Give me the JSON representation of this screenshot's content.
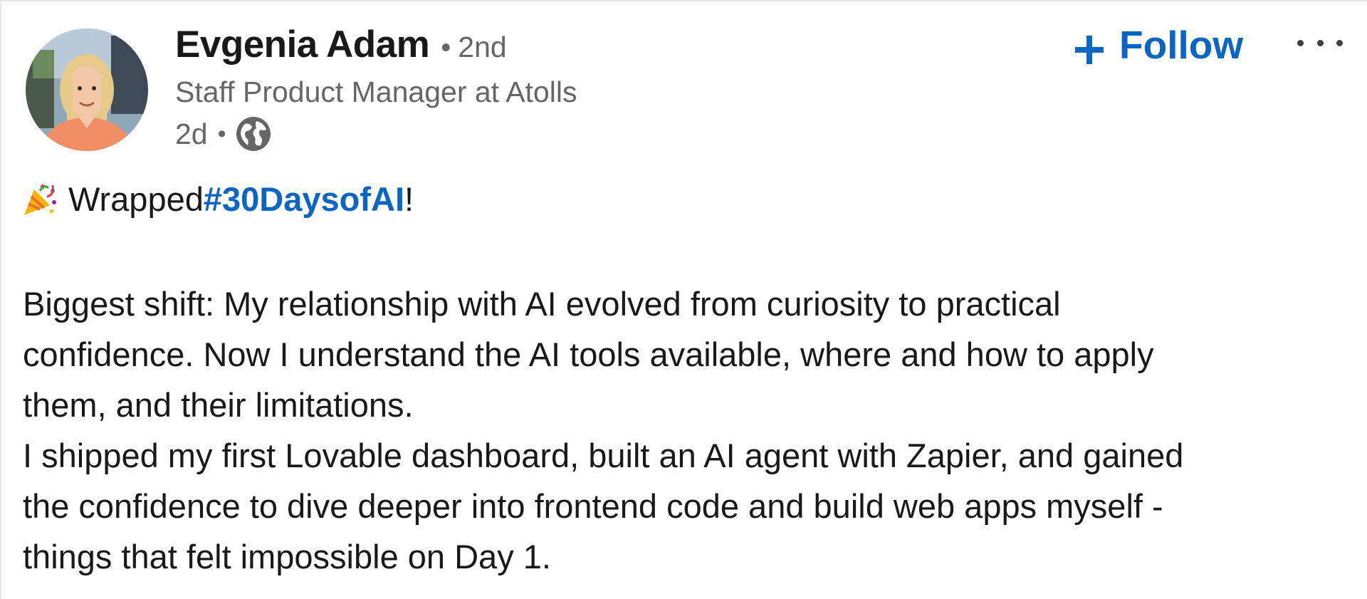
{
  "author": {
    "name": "Evgenia Adam",
    "degree": "2nd",
    "headline": "Staff Product Manager at Atolls",
    "post_age": "2d",
    "separator": "•",
    "avatar_icon": "profile-photo",
    "visibility_icon": "globe-icon"
  },
  "actions": {
    "follow_label": "Follow",
    "follow_icon": "plus-icon",
    "more_icon": "ellipsis-icon"
  },
  "post": {
    "intro_emoji_icon": "party-popper-icon",
    "intro_prefix": "Wrapped ",
    "hashtag": "#30DaysofAI",
    "intro_suffix": "!",
    "paragraph_1_line_1": "Biggest shift: My relationship with AI evolved from curiosity to practical",
    "paragraph_1_line_2": "confidence. Now I understand the AI tools available, where and how to apply",
    "paragraph_1_line_3": "them, and their limitations.",
    "paragraph_2_line_1": "I shipped my first Lovable dashboard, built an AI agent with Zapier, and gained",
    "paragraph_2_line_2": "the confidence to dive deeper into frontend code and build web apps myself -",
    "paragraph_2_line_3": "things that felt impossible on Day 1."
  },
  "colors": {
    "link_blue": "#0a66c2",
    "text_primary": "#191919",
    "text_secondary": "#666666"
  }
}
